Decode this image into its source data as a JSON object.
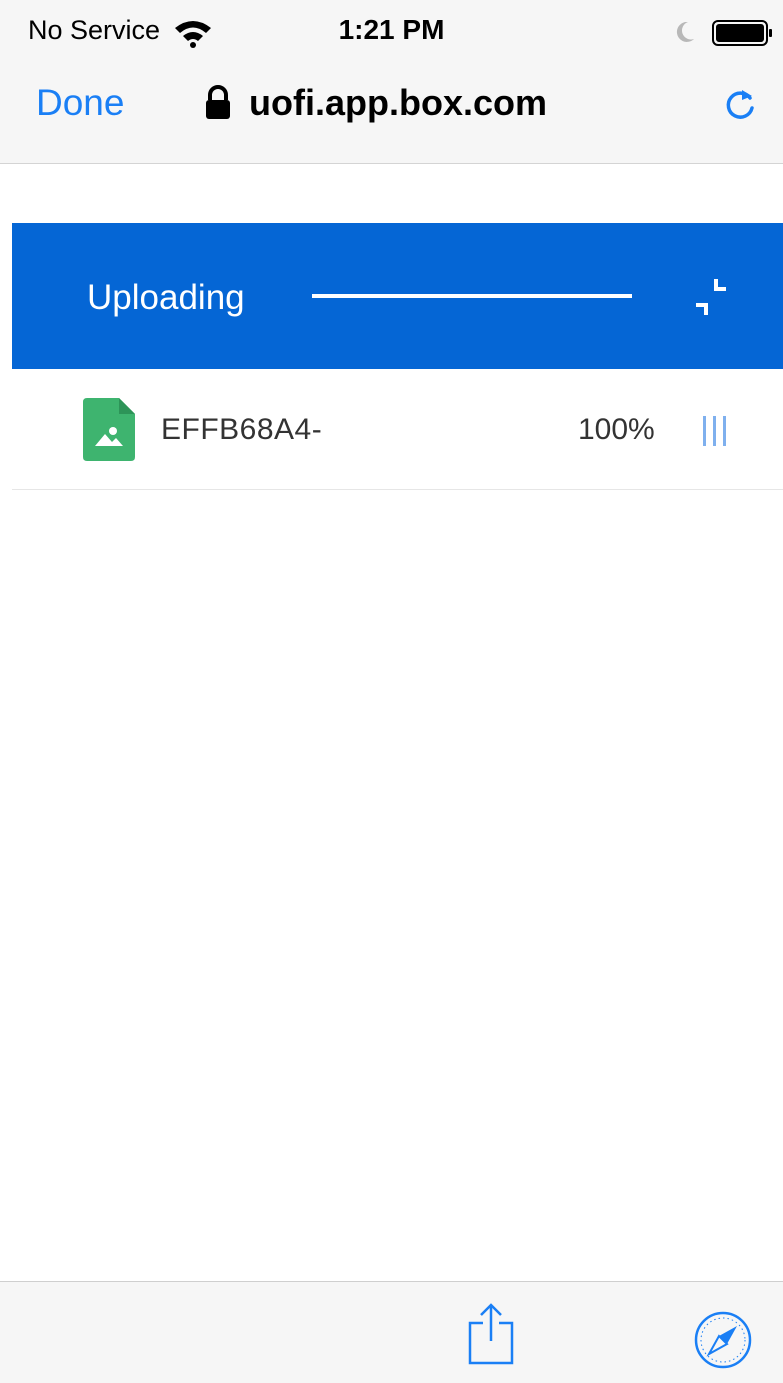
{
  "status_bar": {
    "carrier": "No Service",
    "time": "1:21 PM",
    "icons": [
      "wifi-icon",
      "moon-icon",
      "battery-icon"
    ]
  },
  "browser": {
    "done_label": "Done",
    "url": "uofi.app.box.com",
    "icons": [
      "lock-icon",
      "reload-icon",
      "share-icon",
      "safari-compass-icon"
    ],
    "accent_color": "#1a7ff5"
  },
  "uploader": {
    "title": "Uploading",
    "progress": 1.0,
    "header_color": "#0566d5",
    "icons": [
      "collapse-icon"
    ],
    "files": [
      {
        "name": "EFFB68A4-",
        "percent": "100%",
        "icon": "image-file-icon",
        "icon_color": "#3eb46f",
        "status_icon": "processing-bars-icon"
      }
    ]
  }
}
